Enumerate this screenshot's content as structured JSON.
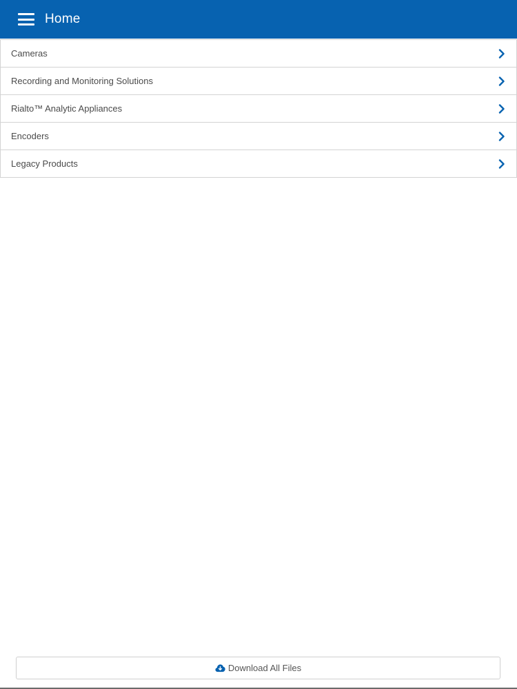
{
  "header": {
    "title": "Home",
    "menu_icon": "hamburger-menu-icon",
    "background_color": "#0762b0"
  },
  "menu": {
    "items": [
      {
        "label": "Cameras"
      },
      {
        "label": "Recording and Monitoring Solutions"
      },
      {
        "label": "Rialto™ Analytic Appliances"
      },
      {
        "label": "Encoders"
      },
      {
        "label": "Legacy Products"
      }
    ],
    "chevron_icon": "chevron-right-icon",
    "chevron_color": "#0762b0"
  },
  "footer": {
    "download_label": "Download All Files",
    "download_icon": "cloud-download-icon"
  }
}
